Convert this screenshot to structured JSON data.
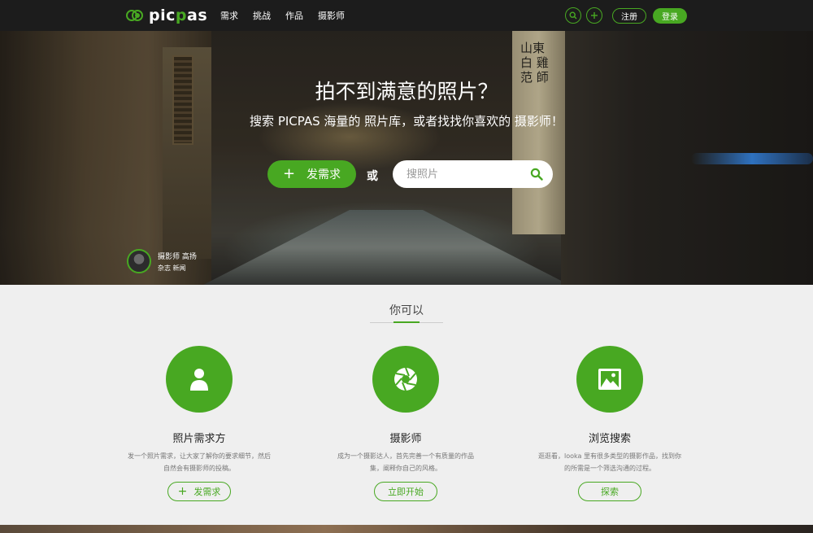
{
  "brand": {
    "logo_text_pre": "pic",
    "logo_text_mid": "p",
    "logo_text_post": "as",
    "accent_color": "#48a822"
  },
  "nav": {
    "links": [
      "需求",
      "挑战",
      "作品",
      "摄影师"
    ],
    "search_icon": "search-icon",
    "add_icon": "plus-icon",
    "register_label": "注册",
    "login_label": "登录"
  },
  "hero": {
    "title": "拍不到满意的照片？",
    "subtitle": "搜索 PICPAS 海量的 照片库，或者找找你喜欢的 摄影师！",
    "post_button_label": "发需求",
    "or_label": "或",
    "search_placeholder": "搜照片",
    "pillar_text": "山東 白 雞 范 師",
    "credit_name": "摄影师 高扬",
    "credit_tags": "杂志 新闻"
  },
  "section": {
    "title": "你可以",
    "features": [
      {
        "icon": "user-icon",
        "title": "照片需求方",
        "desc": "发一个照片需求，让大家了解你的要求细节，然后自然会有摄影师的投稿。",
        "button": "发需求"
      },
      {
        "icon": "aperture-icon",
        "title": "摄影师",
        "desc": "成为一个摄影达人，首先完善一个有质量的作品集，阐释你自己的风格。",
        "button": "立即开始"
      },
      {
        "icon": "image-icon",
        "title": "浏览搜索",
        "desc": "逛逛看，looka 里有很多类型的摄影作品，找到你的所需是一个筛选沟通的过程。",
        "button": "探索"
      }
    ]
  }
}
